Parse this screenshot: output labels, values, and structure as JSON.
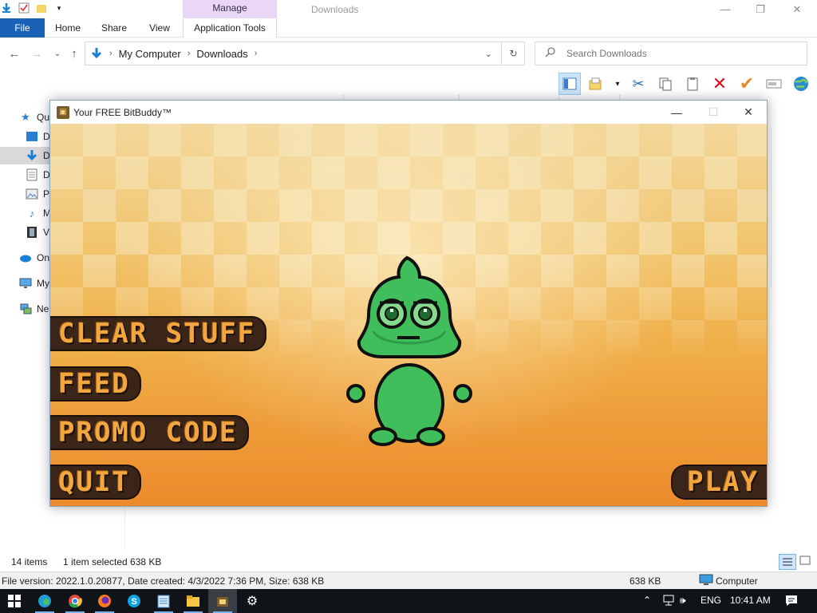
{
  "explorer": {
    "manage_tab": "Manage",
    "window_title": "Downloads",
    "ribbon_tabs": [
      "File",
      "Home",
      "Share",
      "View",
      "Application Tools"
    ],
    "address": {
      "root": "My Computer",
      "current": "Downloads"
    },
    "search": {
      "placeholder": "Search Downloads",
      "value": ""
    },
    "nav_pane": [
      {
        "label": "Qu",
        "icon": "quick-access-star-icon"
      },
      {
        "label": "D",
        "icon": "desktop-folder-icon"
      },
      {
        "label": "D",
        "icon": "downloads-arrow-icon",
        "selected": true
      },
      {
        "label": "D",
        "icon": "documents-icon"
      },
      {
        "label": "Pi",
        "icon": "pictures-icon"
      },
      {
        "label": "M",
        "icon": "music-note-icon"
      },
      {
        "label": "Vi",
        "icon": "videos-film-icon"
      },
      {
        "label": "On",
        "icon": "onedrive-cloud-icon"
      },
      {
        "label": "My",
        "icon": "computer-monitor-icon"
      },
      {
        "label": "Ne",
        "icon": "network-icon"
      }
    ],
    "status": {
      "items": "14 items",
      "selected": "1 item selected  638 KB"
    },
    "file_info": {
      "details": "File version: 2022.1.0.20877, Date created: 4/3/2022 7:36 PM, Size: 638 KB",
      "size": "638 KB",
      "location": "Computer"
    }
  },
  "game": {
    "title": "Your FREE BitBuddy™",
    "menu": {
      "clear": "CLEAR STUFF",
      "feed": "FEED",
      "promo": "PROMO CODE",
      "quit": "QUIT",
      "play": "PLAY"
    }
  },
  "taskbar": {
    "language": "ENG",
    "time": "10:41 AM"
  }
}
